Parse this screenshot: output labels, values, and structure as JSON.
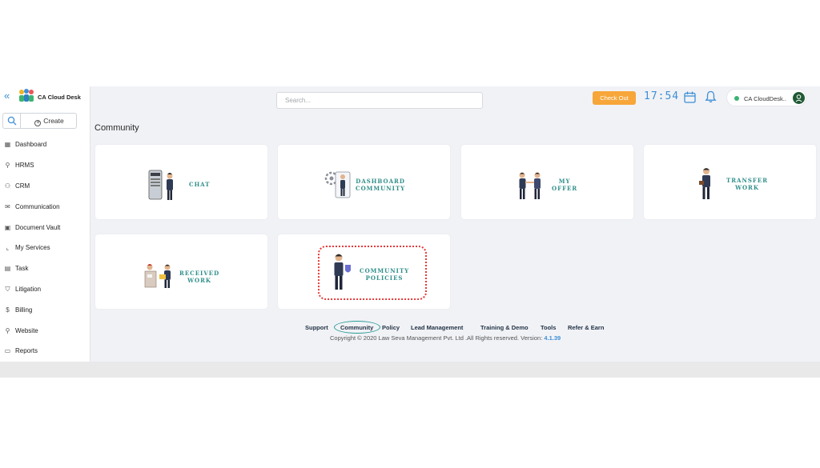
{
  "sidebar": {
    "brand_name": "CA Cloud Desk",
    "create_label": "Create",
    "items": [
      {
        "label": "Dashboard",
        "icon": "grid-icon"
      },
      {
        "label": "HRMS",
        "icon": "user-icon"
      },
      {
        "label": "CRM",
        "icon": "users-icon"
      },
      {
        "label": "Communication",
        "icon": "mail-icon"
      },
      {
        "label": "Document Vault",
        "icon": "vault-icon"
      },
      {
        "label": "My Services",
        "icon": "chart-icon"
      },
      {
        "label": "Task",
        "icon": "task-icon"
      },
      {
        "label": "Litigation",
        "icon": "shield-icon"
      },
      {
        "label": "Billing",
        "icon": "dollar-icon"
      },
      {
        "label": "Website",
        "icon": "user-icon"
      },
      {
        "label": "Reports",
        "icon": "reports-icon"
      }
    ]
  },
  "topbar": {
    "search_placeholder": "Search...",
    "checkout_label": "Check Out",
    "clock": "17:54",
    "user_name": "CA CloudDesk.."
  },
  "main": {
    "page_title": "Community",
    "cards": [
      {
        "label": "CHAT"
      },
      {
        "label": "DASHBOARD\nCOMMUNITY"
      },
      {
        "label": "MY\nOFFER"
      },
      {
        "label": "TRANSFER\nWORK"
      },
      {
        "label": "RECEIVED\nWORK"
      },
      {
        "label": "COMMUNITY\nPOLICIES"
      }
    ]
  },
  "footer": {
    "links": [
      "Support",
      "Community",
      "Policy",
      "Lead Management",
      "Training & Demo",
      "Tools",
      "Refer & Earn"
    ],
    "copyright": "Copyright © 2020 Law Seva Management Pvt. Ltd .All Rights reserved.",
    "version_label": "Version:",
    "version": "4.1.39"
  },
  "colors": {
    "accent": "#3d8fd6",
    "checkout": "#f7a63a",
    "card_label": "#2f8f8a",
    "highlight": "#e33a3a"
  }
}
